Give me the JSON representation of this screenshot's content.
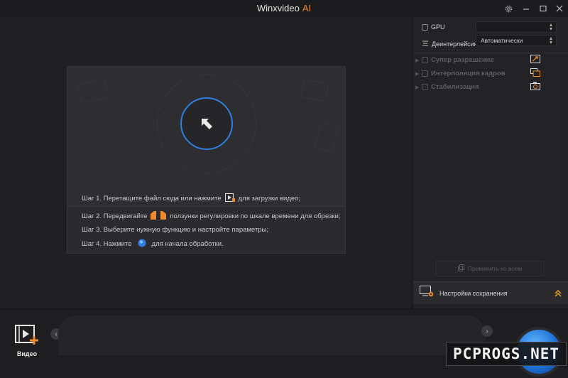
{
  "app": {
    "title": "Winxvideo",
    "title_suffix": "AI"
  },
  "window": {
    "settings_icon": "gear-icon",
    "minimize_icon": "minimize-icon",
    "maximize_icon": "maximize-icon",
    "close_icon": "close-icon"
  },
  "dropzone": {
    "import_icon": "import-arrow-icon",
    "steps": {
      "s1_a": "Шаг 1. Перетащите файл сюда или нажмите",
      "s1_b": "для загрузки видео;",
      "s2_a": "Шаг 2. Передвигайте",
      "s2_b": "ползунки регулировки по шкале времени для обрезки;",
      "s3": "Шаг 3. Выберите нужную функцию и настройте параметры;",
      "s4_a": "Шаг 4. Нажмите",
      "s4_b": "для начала обработки."
    }
  },
  "settings": {
    "gpu_label": "GPU",
    "gpu_checked": false,
    "gpu_value": "",
    "deinterlace_label": "Деинтерлейсинг",
    "deinterlace_value": "Автоматически",
    "effects": [
      {
        "label": "Супер разрешение",
        "icon": "upscale-icon",
        "enabled": false
      },
      {
        "label": "Интерполяция кадров",
        "icon": "frame-interpolation-icon",
        "enabled": false
      },
      {
        "label": "Стабилизация",
        "icon": "stabilization-icon",
        "enabled": false
      }
    ],
    "apply_all_label": "Применить ко всем",
    "save_settings_label": "Настройки сохранения"
  },
  "bottombar": {
    "add_video_label": "Видео",
    "run_icon": "run-icon"
  },
  "watermark": {
    "text": "PCPROGS.NET"
  },
  "colors": {
    "accent": "#2f7fde",
    "brand_orange": "#f08b2d"
  }
}
